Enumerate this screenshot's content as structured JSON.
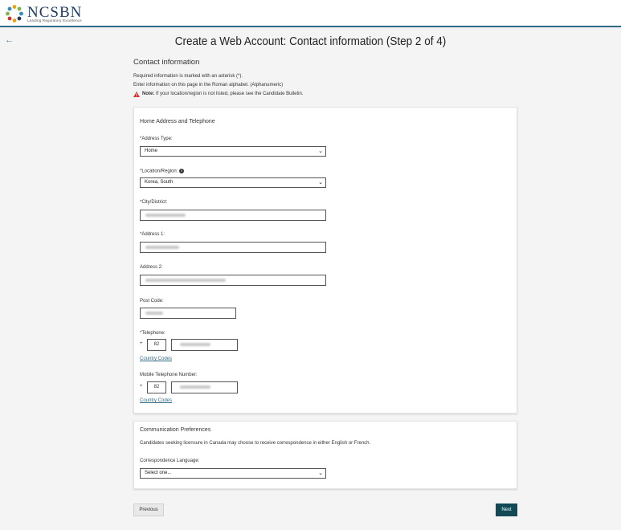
{
  "header": {
    "brand": "NCSBN",
    "tagline": "Leading Regulatory Excellence"
  },
  "page": {
    "title": "Create a Web Account: Contact information (Step 2 of 4)"
  },
  "intro": {
    "heading": "Contact information",
    "line1": "Required information is marked with an asterisk (*).",
    "line2": "Enter information on this page in the Roman alphabet. (Alphanumeric)",
    "note_bold": "Note:",
    "note_text": " If your location/region is not listed, please see the Candidate Bulletin."
  },
  "home_section": {
    "title": "Home Address and Telephone",
    "address_type_label": "*Address Type:",
    "address_type_value": "Home",
    "location_label": "*Location/Region:",
    "location_value": "Korea, South",
    "city_label": "*City/District:",
    "address1_label": "*Address 1:",
    "address2_label": "Address 2:",
    "postcode_label": "Post Code:",
    "telephone_label": "*Telephone:",
    "telephone_plus": "+",
    "telephone_country_code": "82",
    "telephone_link": "Country Codes",
    "mobile_label": "Mobile Telephone Number:",
    "mobile_plus": "+",
    "mobile_country_code": "82",
    "mobile_link": "Country Codes"
  },
  "comm_section": {
    "title": "Communication Preferences",
    "description": "Candidates seeking licensure in Canada may choose to receive correspondence in either English or French.",
    "language_label": "Correspondence Language:",
    "language_value": "Select one..."
  },
  "buttons": {
    "previous": "Previous",
    "next": "Next"
  },
  "colors": {
    "accent": "#2e6a86",
    "next_button": "#114a56",
    "warning": "#d0312d"
  }
}
